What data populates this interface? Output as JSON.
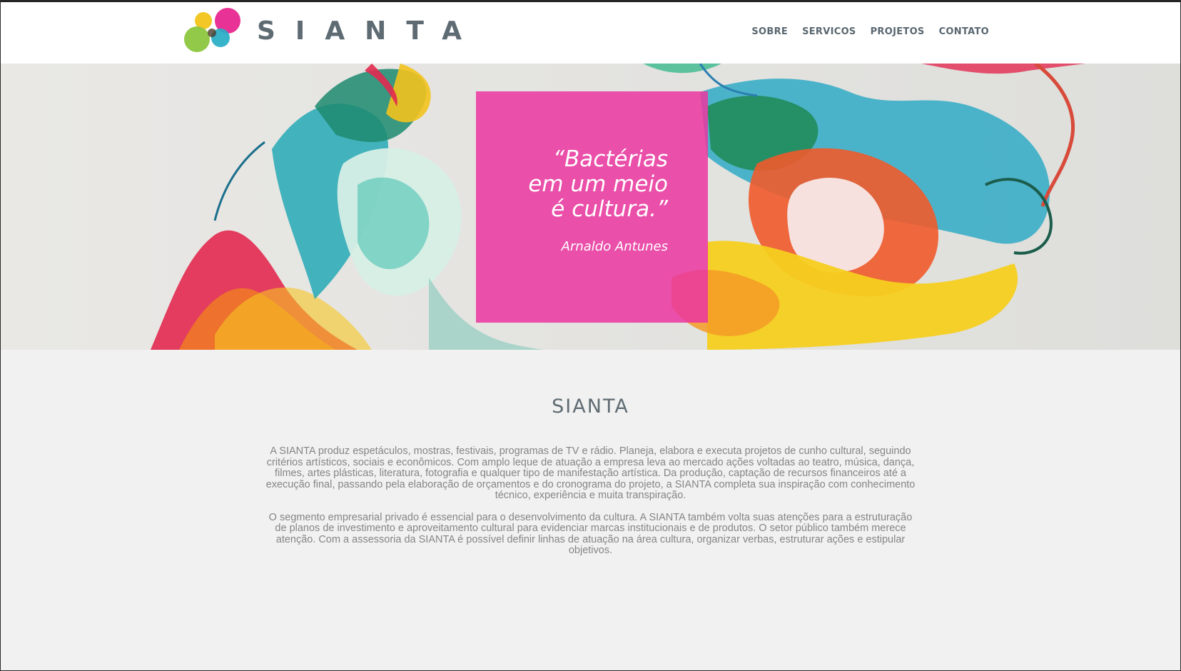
{
  "brand": {
    "name": "SIANTA",
    "colors": {
      "magenta": "#e8278f",
      "yellow": "#f2c419",
      "green": "#8cc63f",
      "cyan": "#27aec6",
      "text": "#5f6b73"
    }
  },
  "nav": {
    "items": [
      {
        "label": "SOBRE"
      },
      {
        "label": "SERVICOS"
      },
      {
        "label": "PROJETOS"
      },
      {
        "label": "CONTATO"
      }
    ]
  },
  "hero": {
    "quote": "“Bactérias\nem um meio\né cultura.”",
    "author": "Arnaldo Antunes",
    "box_color": "#eb37a0"
  },
  "about": {
    "title": "SIANTA",
    "paragraphs": [
      "A SIANTA produz espetáculos, mostras, festivais, programas de TV e rádio. Planeja, elabora e executa projetos de cunho cultural, seguindo critérios artísticos, sociais e econômicos. Com amplo leque de atuação a empresa leva ao mercado ações voltadas ao teatro, música, dança, filmes, artes plásticas, literatura, fotografia e qualquer tipo de manifestação artística. Da produção, captação de recursos financeiros até a execução final, passando pela elaboração de orçamentos e do cronograma do projeto, a SIANTA completa sua inspiração com conhecimento técnico, experiência e muita transpiração.",
      "O segmento empresarial privado é essencial para o desenvolvimento da cultura. A SIANTA também volta suas atenções para a estruturação de planos de investimento e aproveitamento cultural para evidenciar marcas institucionais e de produtos. O setor público também merece atenção. Com a assessoria da SIANTA é possível definir linhas de atuação na área cultura, organizar verbas, estruturar ações e estipular objetivos."
    ]
  }
}
